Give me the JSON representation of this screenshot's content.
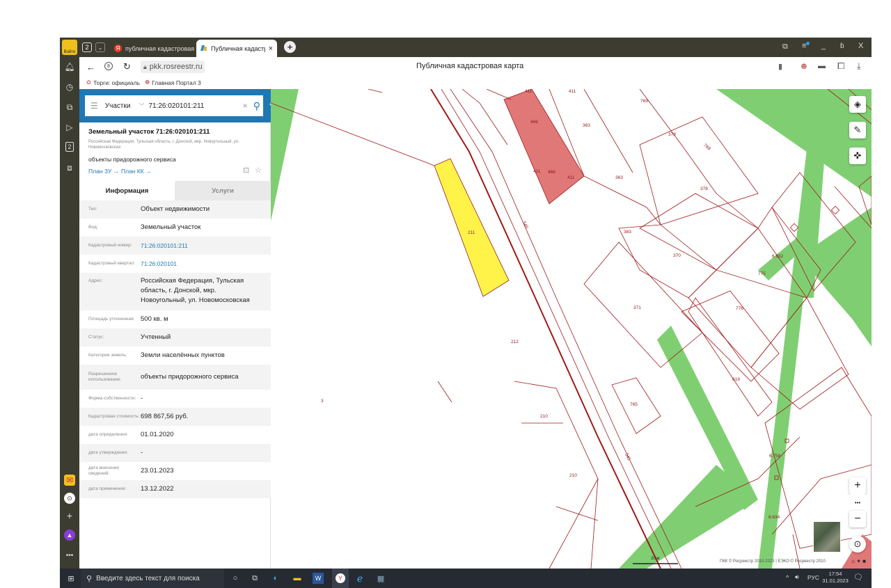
{
  "browser": {
    "login_label": "Войти",
    "tab_count": "2",
    "tabs": [
      {
        "title": "публичная кадастровая к"
      },
      {
        "title": "Публичная кадастрова"
      }
    ],
    "close_tab": "×",
    "new_tab": "+",
    "window_controls": [
      "_",
      "ɓ",
      "X"
    ],
    "url": "pkk.rosreestr.ru",
    "page_title": "Публичная кадастровая карта",
    "bookmarks": [
      "Торги: официаль",
      "Главная Портал 3"
    ]
  },
  "panel": {
    "search": {
      "category": "Участки",
      "query": "71:26:020101:211"
    },
    "parcel_title": "Земельный участок 71:26:020101:211",
    "address_short": "Российская Федерация, Тульская область, г. Донской, мкр. Новоугольный, ул. Новомосковская",
    "usage": "объекты придорожного сервиса",
    "links": [
      "План ЗУ →",
      "План КК →"
    ],
    "tabs": [
      "Информация",
      "Услуги"
    ],
    "rows": [
      {
        "key": "Тип:",
        "value": "Объект недвижимости"
      },
      {
        "key": "Вид:",
        "value": "Земельный участок"
      },
      {
        "key": "Кадастровый номер:",
        "value": "71:26:020101:211"
      },
      {
        "key": "Кадастровый квартал:",
        "value": "71:26:020101"
      },
      {
        "key": "Адрес:",
        "value": "Российская Федерация, Тульская область, г. Донской, мкр. Новоугольный, ул. Новомосковская"
      },
      {
        "key": "Площадь уточненная:",
        "value": "500 кв. м"
      },
      {
        "key": "Статус:",
        "value": "Учтенный"
      },
      {
        "key": "Категория земель:",
        "value": "Земли населённых пунктов"
      },
      {
        "key": "Разрешенное использование:",
        "value": "объекты придорожного сервиса"
      },
      {
        "key": "Форма собственности:",
        "value": "-"
      },
      {
        "key": "Кадастровая стоимость:",
        "value": "698 867,56 руб."
      },
      {
        "key": "дата определения:",
        "value": "01.01.2020"
      },
      {
        "key": "дата утверждения:",
        "value": "-"
      },
      {
        "key": "дата внесения сведений:",
        "value": "23.01.2023"
      },
      {
        "key": "дата применения:",
        "value": "13.12.2022"
      }
    ]
  },
  "map": {
    "labels": [
      "411",
      "411",
      "466",
      "466",
      "411",
      "411",
      "363",
      "363",
      "769",
      "378",
      "378",
      "769",
      "383",
      "370",
      "211",
      "545",
      "6.932",
      "775",
      "371",
      "776",
      "212",
      "619",
      "765",
      "210",
      "3",
      "545",
      "210",
      "6.758",
      "6.634"
    ],
    "scale": "20 м",
    "copyright": "ПКК © Росреестр 2010-2023 | ЕЭКО © Росреестр 2010",
    "controls": [
      "+",
      "•••",
      "−"
    ]
  },
  "taskbar": {
    "search_placeholder": "Введите здесь текст для поиска",
    "lang": "РУС",
    "time": "17:54",
    "date": "31.01.2023"
  },
  "colors": {
    "accent": "#1f78b4",
    "parcel_border": "#a01818",
    "green": "#7fcf72",
    "yellow": "#fff34a",
    "building": "#e07878"
  }
}
